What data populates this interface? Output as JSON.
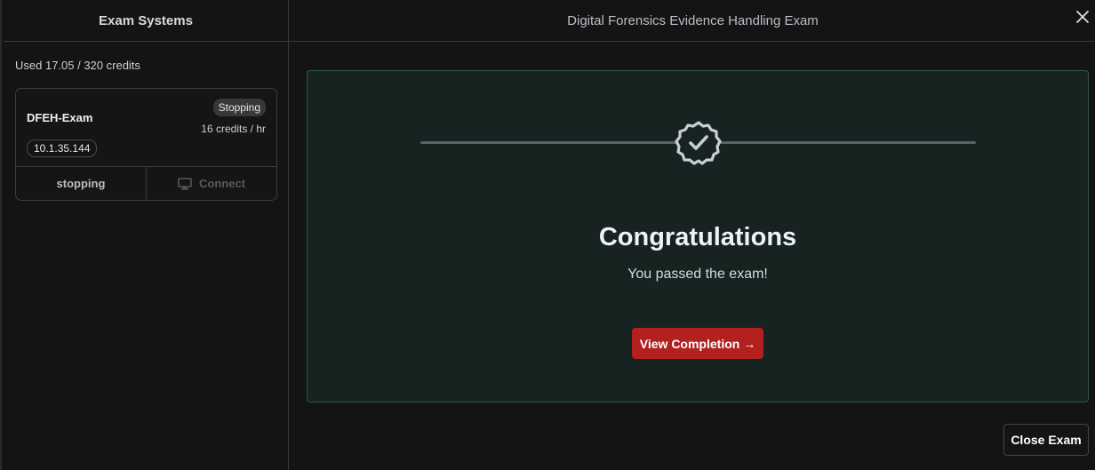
{
  "sidebar": {
    "title": "Exam Systems",
    "credits_text": "Used 17.05 / 320 credits",
    "machine": {
      "name": "DFEH-Exam",
      "status": "Stopping",
      "rate": "16 credits / hr",
      "ip": "10.1.35.144",
      "stop_label": "stopping",
      "connect_label": "Connect",
      "connect_icon": "monitor-icon"
    }
  },
  "main": {
    "title": "Digital Forensics Evidence Handling Exam",
    "close_icon": "close-icon",
    "result": {
      "badge_icon": "check-badge-icon",
      "heading": "Congratulations",
      "message": "You passed the exam!",
      "button_label": "View Completion →"
    },
    "close_exam_label": "Close Exam"
  },
  "colors": {
    "accent_button": "#b3211f",
    "panel_bg": "#172320",
    "panel_border": "#2c5a44"
  }
}
